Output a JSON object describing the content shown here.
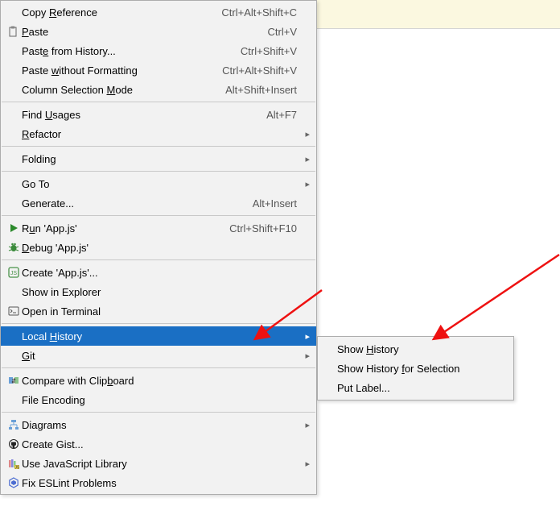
{
  "menu": {
    "copyRef": {
      "label": "Copy Reference",
      "shortcut": "Ctrl+Alt+Shift+C",
      "mn": "R"
    },
    "paste": {
      "label": "Paste",
      "shortcut": "Ctrl+V",
      "mn": "P"
    },
    "pasteHistory": {
      "label": "Paste from History...",
      "shortcut": "Ctrl+Shift+V",
      "mn": "e"
    },
    "pasteNoFmt": {
      "label": "Paste without Formatting",
      "shortcut": "Ctrl+Alt+Shift+V",
      "mn": "w"
    },
    "colSelMode": {
      "label": "Column Selection Mode",
      "shortcut": "Alt+Shift+Insert",
      "mn": "M"
    },
    "findUsages": {
      "label": "Find Usages",
      "shortcut": "Alt+F7",
      "mn": "U"
    },
    "refactor": {
      "label": "Refactor",
      "arrow": true,
      "mn": "R"
    },
    "folding": {
      "label": "Folding",
      "arrow": true
    },
    "goto": {
      "label": "Go To",
      "arrow": true
    },
    "generate": {
      "label": "Generate...",
      "shortcut": "Alt+Insert"
    },
    "run": {
      "label": "Run 'App.js'",
      "shortcut": "Ctrl+Shift+F10",
      "mn": "u"
    },
    "debug": {
      "label": "Debug 'App.js'",
      "mn": "D"
    },
    "create": {
      "label": "Create 'App.js'..."
    },
    "showExplorer": {
      "label": "Show in Explorer"
    },
    "openTerminal": {
      "label": "Open in Terminal"
    },
    "localHistory": {
      "label": "Local History",
      "arrow": true,
      "mn": "H"
    },
    "git": {
      "label": "Git",
      "arrow": true,
      "mn": "G"
    },
    "compareClip": {
      "label": "Compare with Clipboard",
      "mn": "b"
    },
    "fileEncoding": {
      "label": "File Encoding"
    },
    "diagrams": {
      "label": "Diagrams",
      "arrow": true
    },
    "createGist": {
      "label": "Create Gist..."
    },
    "jsLib": {
      "label": "Use JavaScript Library",
      "arrow": true
    },
    "eslint": {
      "label": "Fix ESLint Problems"
    }
  },
  "submenu": {
    "showHistory": {
      "label": "Show History",
      "mn": "H"
    },
    "showHistSel": {
      "label": "Show History for Selection",
      "mn": "f"
    },
    "putLabel": {
      "label": "Put Label..."
    }
  }
}
